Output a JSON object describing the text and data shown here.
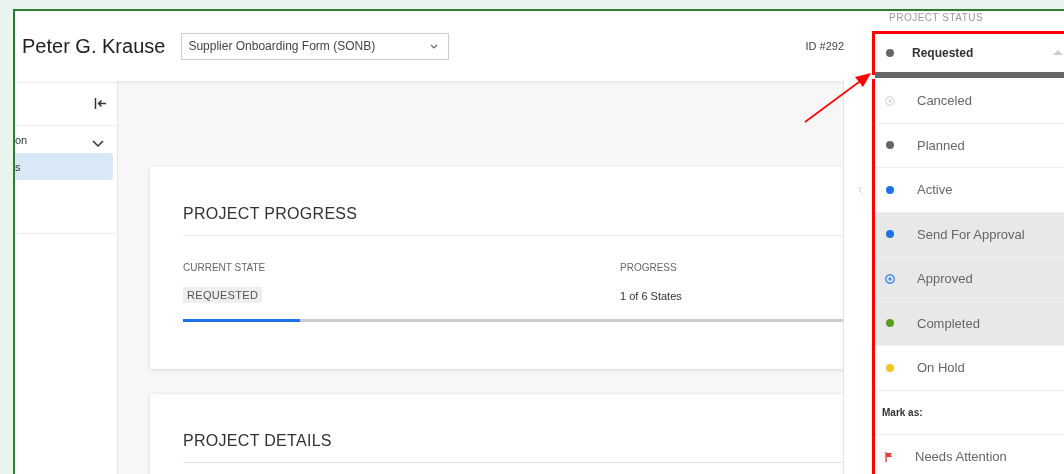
{
  "header": {
    "title": "Peter G. Krause",
    "form_select": {
      "value": "Supplier Onboarding Form (SONB)"
    },
    "id_label": "ID #292"
  },
  "sidebar": {
    "items": [
      {
        "label": "on",
        "expanded": true,
        "selected": false
      },
      {
        "label": "s",
        "selected": true
      }
    ]
  },
  "progress_card": {
    "title": "PROJECT PROGRESS",
    "current_state_label": "CURRENT STATE",
    "current_state": "REQUESTED",
    "progress_label": "PROGRESS",
    "progress_text": "1 of 6 States",
    "level": 0.167
  },
  "details_card": {
    "title": "PROJECT DETAILS"
  },
  "status_dropdown": {
    "label": "PROJECT STATUS",
    "value": "Requested",
    "expanded": true,
    "options": [
      {
        "label": "Canceled",
        "kind": "canceled",
        "color": "#cccccc",
        "highlighted": false
      },
      {
        "label": "Planned",
        "kind": "dot",
        "color": "#666666",
        "highlighted": false
      },
      {
        "label": "Active",
        "kind": "dot",
        "color": "#1a73e8",
        "highlighted": false
      },
      {
        "label": "Send For Approval",
        "kind": "dot",
        "color": "#1a73e8",
        "highlighted": true
      },
      {
        "label": "Approved",
        "kind": "ring",
        "color": "#4a90e2",
        "highlighted": true
      },
      {
        "label": "Completed",
        "kind": "dot",
        "color": "#5a9e1c",
        "highlighted": true
      },
      {
        "label": "On Hold",
        "kind": "dot",
        "color": "#f5c024",
        "highlighted": false
      }
    ],
    "mark_as_label": "Mark as:",
    "marks": [
      {
        "label": "Needs Attention",
        "kind": "flag",
        "color": "#e53935"
      }
    ]
  },
  "annotation": {
    "kind": "box-and-arrow",
    "color": "#ff0000"
  }
}
